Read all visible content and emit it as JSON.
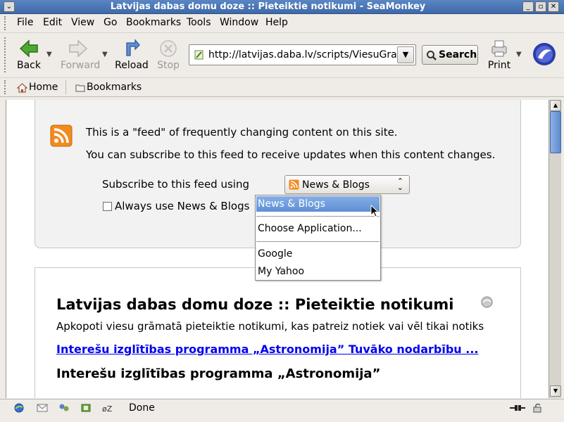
{
  "window": {
    "title": "Latvijas dabas domu doze :: Pieteiktie notikumi - SeaMonkey"
  },
  "menubar": {
    "items": [
      "File",
      "Edit",
      "View",
      "Go",
      "Bookmarks",
      "Tools",
      "Window",
      "Help"
    ]
  },
  "toolbar": {
    "back": "Back",
    "forward": "Forward",
    "reload": "Reload",
    "stop": "Stop",
    "url": "http://latvijas.daba.lv/scripts/ViesuGramata",
    "search": "Search",
    "print": "Print"
  },
  "personal_toolbar": {
    "home": "Home",
    "bookmarks": "Bookmarks"
  },
  "feed": {
    "line1": "This is a \"feed\" of frequently changing content on this site.",
    "line2": "You can subscribe to this feed to receive updates when this content changes.",
    "subscribe_label": "Subscribe to this feed using",
    "selected_reader": "News & Blogs",
    "always_use": "Always use News & Blogs to subscribe to feeds."
  },
  "dropdown": {
    "options": [
      "News & Blogs",
      "Choose Application...",
      "Google",
      "My Yahoo"
    ]
  },
  "page": {
    "title": "Latvijas dabas domu doze :: Pieteiktie notikumi",
    "description": "Apkopoti viesu grāmatā pieteiktie notikumi, kas patreiz notiek vai vēl tikai notiks",
    "entry_link": "Interešu izglītības programma „Astronomija” Tuvāko nodarbību ...",
    "entry_heading": "Interešu izglītības programma „Astronomija”"
  },
  "status": {
    "text": "Done"
  },
  "colors": {
    "titlebar": "#3f69a8",
    "chrome": "#efebe7",
    "link": "#0000ee",
    "selection": "#6b98d9",
    "feed_icon": "#f28a1e"
  }
}
